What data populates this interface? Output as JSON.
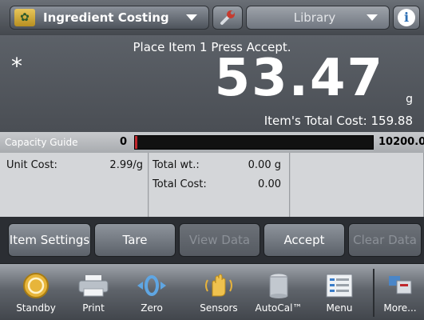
{
  "header": {
    "application": "Ingredient Costing",
    "library": "Library"
  },
  "display": {
    "prompt": "Place Item 1 Press Accept.",
    "stable_indicator": "*",
    "weight": "53.47",
    "unit": "g",
    "total_cost": "Item's Total Cost: 159.88"
  },
  "capacity": {
    "label": "Capacity Guide",
    "min": "0",
    "max": "10200.00",
    "fill_fraction": 0.005,
    "fill_color": "#c0282d"
  },
  "fields": {
    "unit_cost_label": "Unit Cost:",
    "unit_cost_value": "2.99/g",
    "total_wt_label": "Total wt.:",
    "total_wt_value": "0.00 g",
    "total_cost_label": "Total Cost:",
    "total_cost_value": "0.00"
  },
  "softkeys": [
    {
      "label": "Item Settings",
      "enabled": true
    },
    {
      "label": "Tare",
      "enabled": true
    },
    {
      "label": "View Data",
      "enabled": false
    },
    {
      "label": "Accept",
      "enabled": true
    },
    {
      "label": "Clear Data",
      "enabled": false
    }
  ],
  "nav": [
    {
      "label": "Standby",
      "icon": "standby-icon"
    },
    {
      "label": "Print",
      "icon": "printer-icon"
    },
    {
      "label": "Zero",
      "icon": "zero-icon"
    },
    {
      "label": "Sensors",
      "icon": "hand-sensor-icon"
    },
    {
      "label": "AutoCal™",
      "icon": "calibration-weight-icon"
    },
    {
      "label": "Menu",
      "icon": "menu-icon"
    },
    {
      "label": "More...",
      "icon": "more-icon"
    }
  ]
}
